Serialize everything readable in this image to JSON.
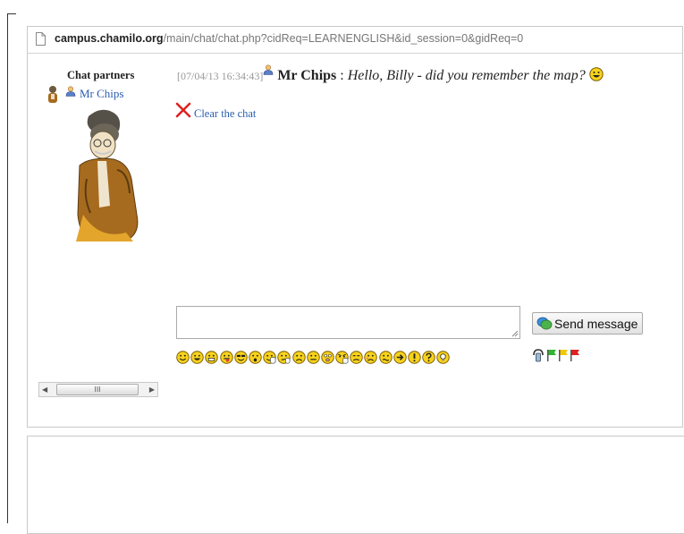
{
  "browser": {
    "url_host": "campus.chamilo.org",
    "url_path": "/main/chat/chat.php?cidReq=LEARNENGLISH&id_session=0&gidReq=0"
  },
  "sidebar": {
    "title": "Chat partners",
    "partners": [
      {
        "name": "Mr Chips",
        "icon": "user-icon"
      }
    ],
    "scrollbar_thumb": "III"
  },
  "messages": [
    {
      "time": "[07/04/13 16:34:43]",
      "author": "Mr Chips",
      "separator": " : ",
      "text": "Hello, Billy - did you remember the map?",
      "emoticon": "laughing-face"
    }
  ],
  "actions": {
    "clear_chat": "Clear the chat",
    "send_message": "Send message"
  },
  "compose": {
    "value": "",
    "placeholder": ""
  },
  "emoticons": [
    "smile",
    "laugh",
    "grin",
    "tongue",
    "cool",
    "surprised",
    "wave",
    "think",
    "sad",
    "neutral",
    "wink",
    "angry",
    "bored",
    "blush",
    "confused",
    "arrow",
    "exclamation",
    "question",
    "idea"
  ],
  "colors": {
    "link": "#2a5db0",
    "emoticon_fill": "#f7d21c",
    "timestamp": "#999999"
  }
}
